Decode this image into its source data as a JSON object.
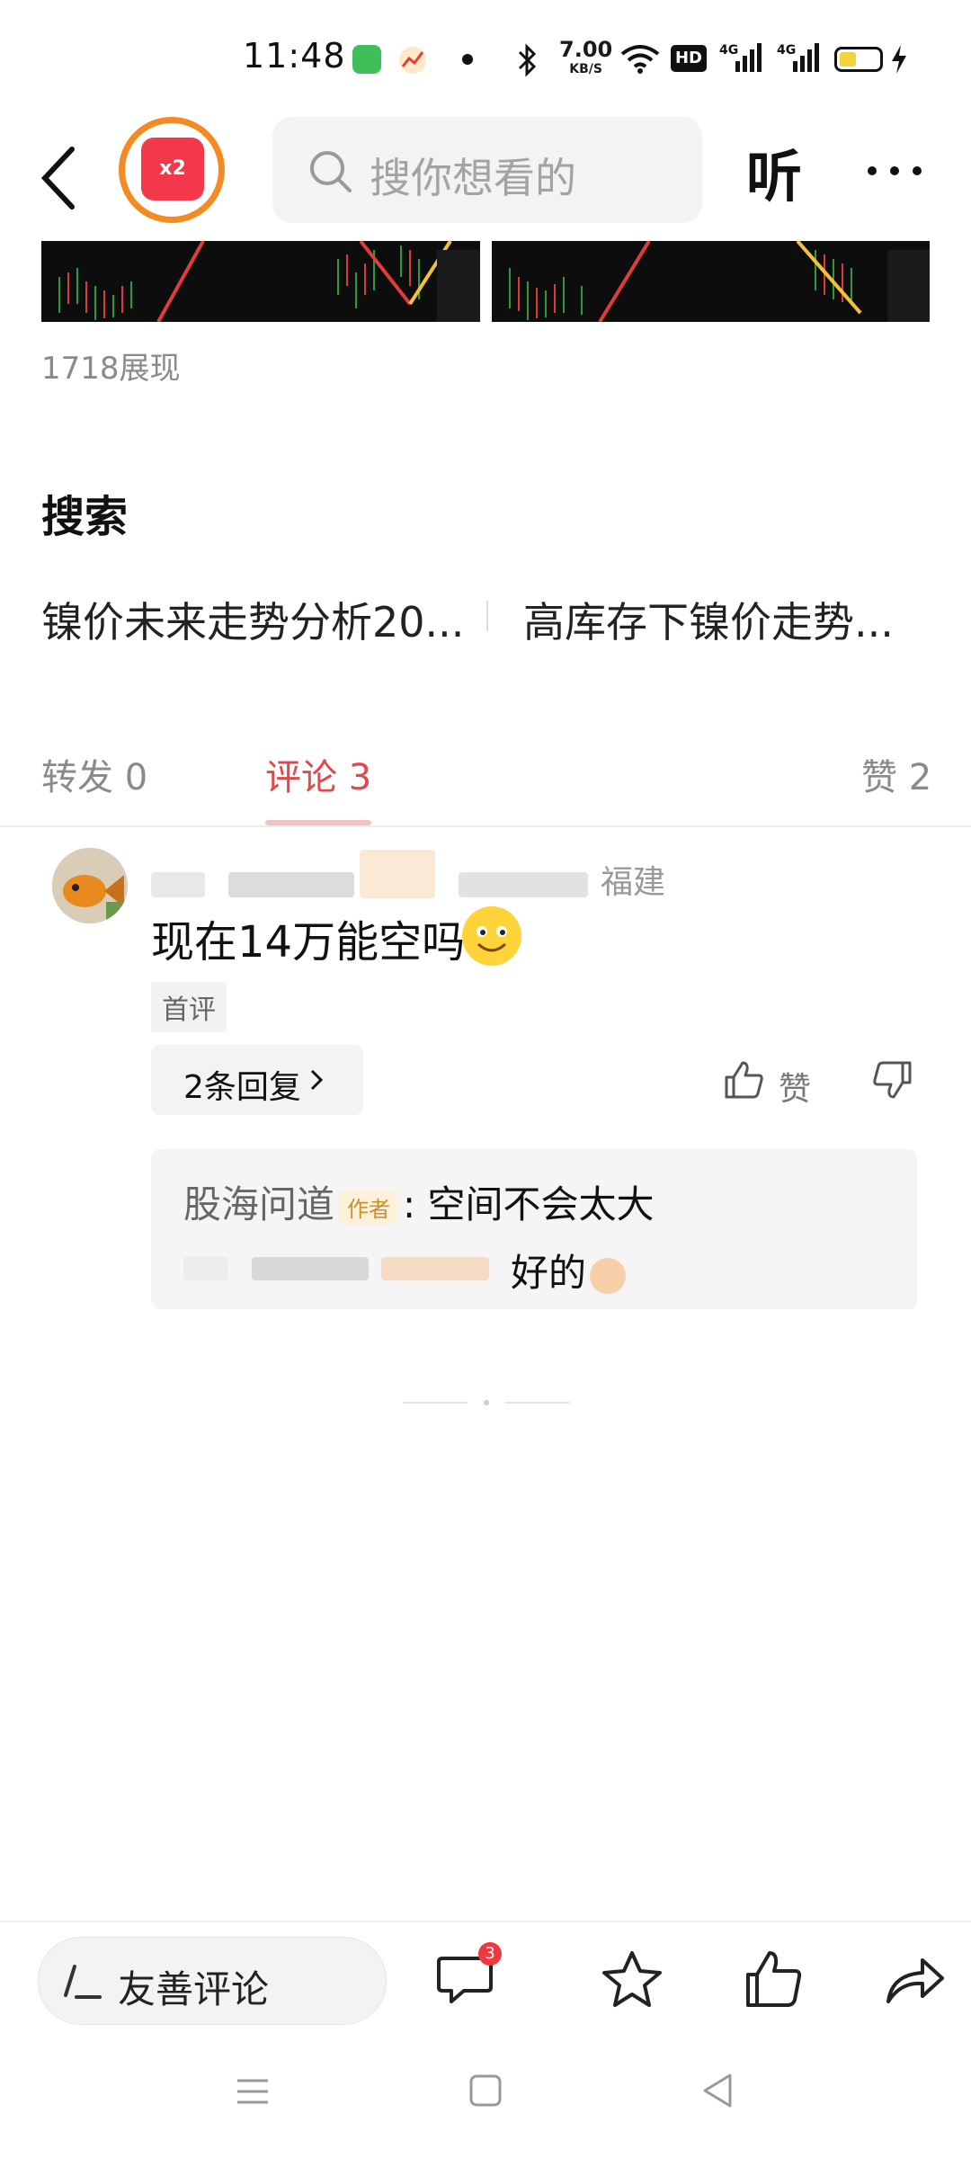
{
  "status_bar": {
    "time": "11:48",
    "net_speed": "7.00",
    "net_unit": "KB/S",
    "icons": [
      "messages-icon",
      "stocks-app-icon",
      "dot-icon",
      "bluetooth-icon",
      "wifi-icon",
      "hd-icon",
      "signal-4g-icon",
      "signal-4g-icon",
      "battery-icon",
      "charging-icon"
    ]
  },
  "header": {
    "badge_text": "x2",
    "search_placeholder": "搜你想看的",
    "listen_label": "听",
    "more_icon": "more-icon"
  },
  "post": {
    "impressions": "1718展现"
  },
  "search_section": {
    "title": "搜索",
    "suggestions": [
      "镍价未来走势分析20...",
      "高库存下镍价走势..."
    ]
  },
  "tabs": [
    {
      "label": "转发 0"
    },
    {
      "label": "评论 3"
    },
    {
      "label": "赞 2"
    }
  ],
  "comment": {
    "location": "福建",
    "text": "现在14万能空吗",
    "first_tag": "首评",
    "replies_button": "2条回复",
    "like_label": "赞",
    "replies": [
      {
        "name": "股海问道",
        "tag": "作者",
        "text": ": 空间不会太大"
      },
      {
        "text": "好的"
      }
    ]
  },
  "bottom_bar": {
    "input_label": "友善评论",
    "comment_count": "3"
  },
  "colors": {
    "accent": "#e0484a",
    "orange": "#f58a22",
    "red": "#f2384a"
  }
}
